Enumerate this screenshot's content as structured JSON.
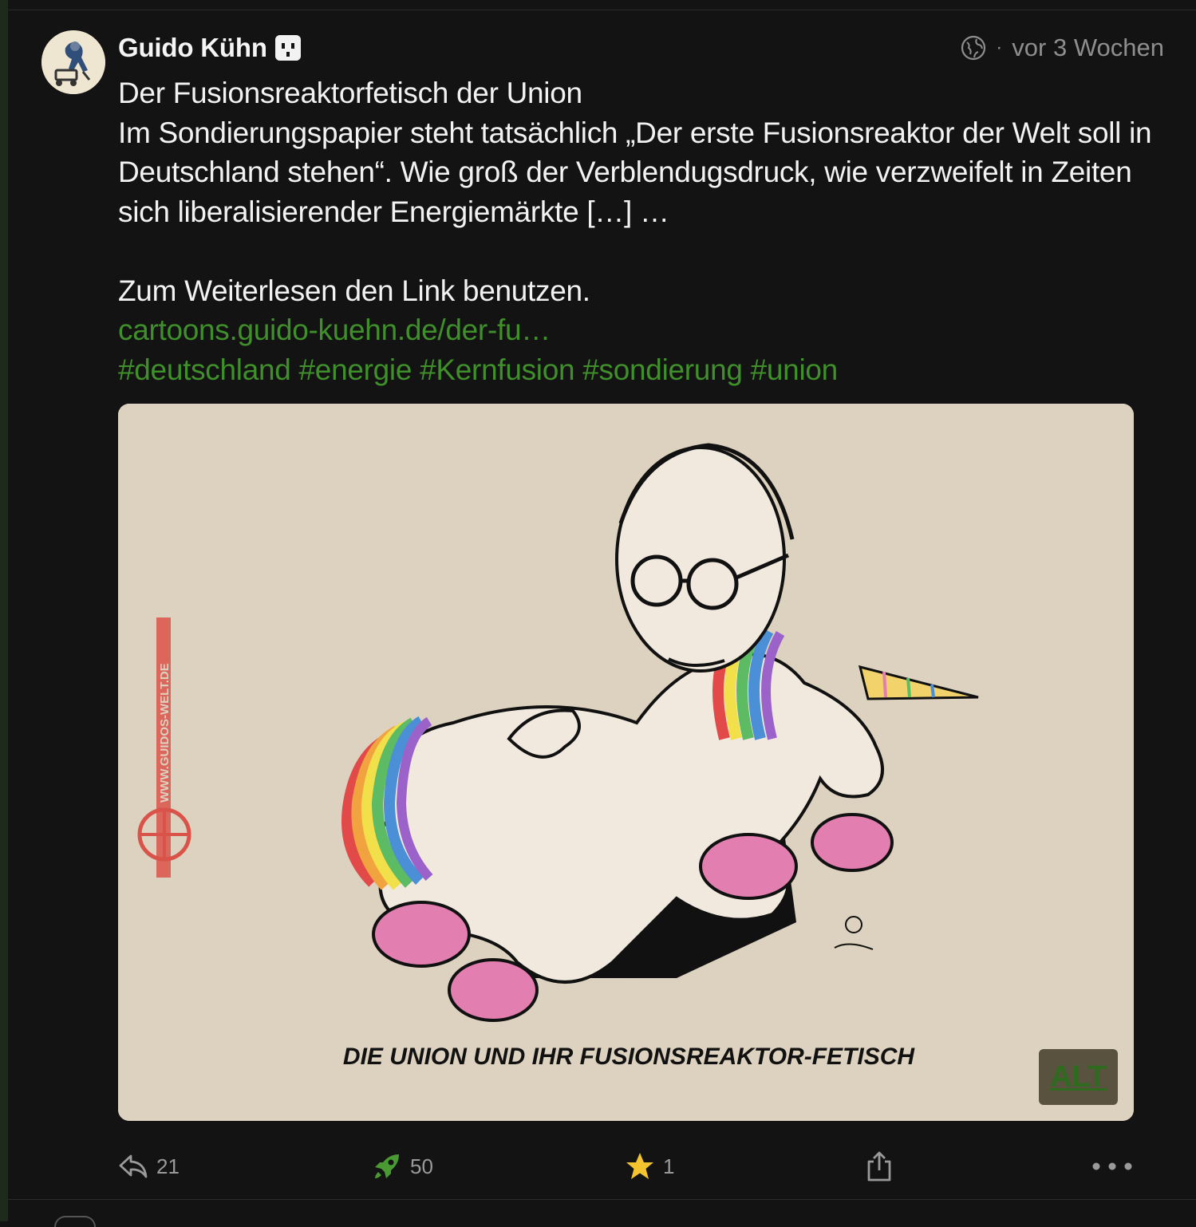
{
  "post": {
    "author": "Guido Kühn",
    "timestamp": "vor 3 Wochen",
    "visibility_icon": "globe-icon",
    "content": {
      "title": "Der Fusionsreaktorfetisch der Union",
      "body": "Im Sondierungspapier steht tatsächlich „Der erste Fusionsreaktor der Welt soll in Deutschland stehen“. Wie groß der Verblendugsdruck, wie verzweifelt in Zeiten sich liberalisierender Energiemärkte […] …",
      "read_more": "Zum Weiterlesen den Link benutzen.",
      "link": "cartoons.guido-kuehn.de/der-fu…",
      "hashtags": [
        "#deutschland",
        "#energie",
        "#Kernfusion",
        "#sondierung",
        "#union"
      ]
    },
    "media": {
      "caption": "DIE UNION UND IHR FUSIONSREAKTOR-FETISCH",
      "watermark": "WWW.GUIDOS-WELT.DE",
      "alt_label": "ALT"
    },
    "actions": {
      "replies": "21",
      "boosts": "50",
      "favourites": "1"
    }
  },
  "colors": {
    "background": "#131313",
    "link": "#3f8f2a",
    "muted": "#8e8e8e",
    "star": "#f4c430",
    "paper": "#ddd1bf"
  }
}
